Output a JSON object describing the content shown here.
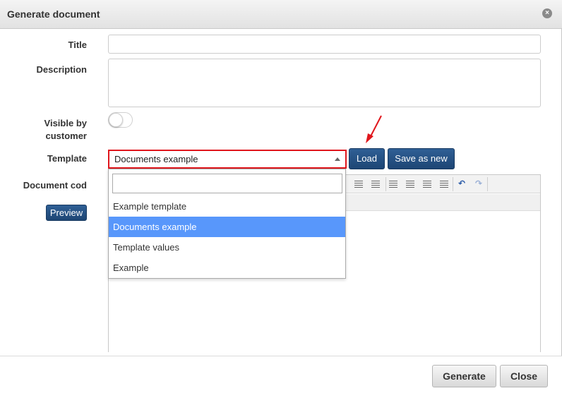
{
  "dialog": {
    "title": "Generate document",
    "close_icon": "×"
  },
  "form": {
    "title_label": "Title",
    "title_value": "",
    "description_label": "Description",
    "description_value": "",
    "visible_label_line1": "Visible by",
    "visible_label_line2": "customer",
    "visible_value": false,
    "template_label": "Template",
    "template_selected": "Documents example",
    "load_button": "Load",
    "save_as_new_button": "Save as new",
    "document_code_label": "Document cod",
    "preview_button": "Preview"
  },
  "dropdown": {
    "search_value": "",
    "options": [
      "Example template",
      "Documents example",
      "Template values",
      "Example"
    ],
    "selected_index": 1
  },
  "footer": {
    "generate_button": "Generate",
    "close_button": "Close"
  },
  "colors": {
    "accent_blue": "#1e4674",
    "highlight": "#5897fb",
    "annotation_red": "#e0161c"
  },
  "icons": [
    "close-icon",
    "outdent-icon",
    "indent-icon",
    "align-left-icon",
    "align-center-icon",
    "align-right-icon",
    "align-justify-icon",
    "undo-icon",
    "redo-icon",
    "dropdown-arrow-icon"
  ]
}
